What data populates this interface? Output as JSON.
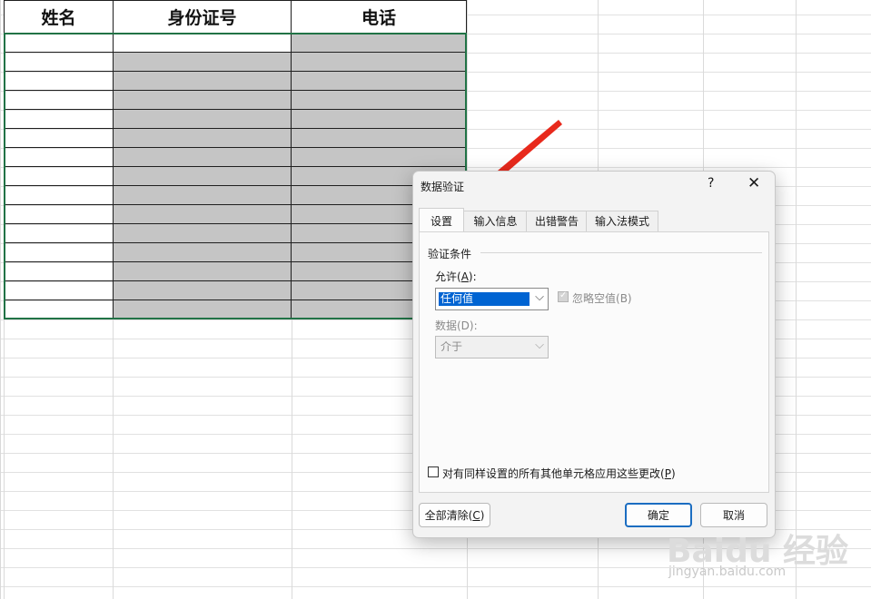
{
  "sheet": {
    "headers": [
      "姓名",
      "身份证号",
      "电话"
    ]
  },
  "dialog": {
    "title": "数据验证",
    "help_glyph": "?",
    "close_glyph": "✕",
    "tabs": [
      {
        "label": "设置"
      },
      {
        "label": "输入信息"
      },
      {
        "label": "出错警告"
      },
      {
        "label": "输入法模式"
      }
    ],
    "group_label": "验证条件",
    "allow_label": "允许",
    "allow_key": "A",
    "allow_value": "任何值",
    "ignore_blank_label": "忽略空值",
    "ignore_blank_key": "(B)",
    "data_label": "数据(D):",
    "data_value": "介于",
    "apply_all_label": "对有同样设置的所有其他单元格应用这些更改",
    "apply_all_key": "P",
    "clear_all_label": "全部清除",
    "clear_all_key": "C",
    "ok_label": "确定",
    "cancel_label": "取消"
  },
  "watermark": {
    "logo": "Baidu 经验",
    "url": "jingyan.baidu.com"
  },
  "colors": {
    "selection": "#217346",
    "arrow": "#e8291c",
    "primary_button": "#1b6dc1",
    "highlight": "#0064d2"
  }
}
